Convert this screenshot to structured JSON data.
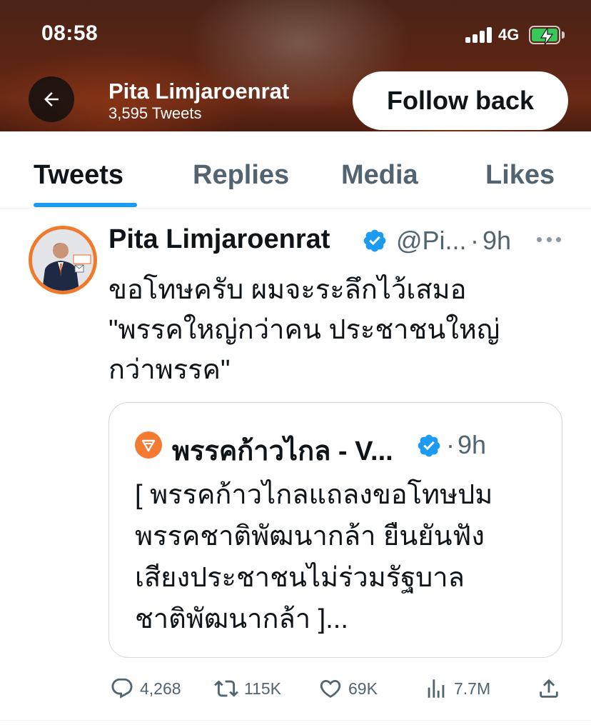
{
  "status_bar": {
    "time": "08:58",
    "network": "4G"
  },
  "profile_header": {
    "name": "Pita Limjaroenrat",
    "tweet_count": "3,595 Tweets",
    "follow_label": "Follow back"
  },
  "tabs": [
    {
      "label": "Tweets",
      "active": true
    },
    {
      "label": "Replies",
      "active": false
    },
    {
      "label": "Media",
      "active": false
    },
    {
      "label": "Likes",
      "active": false
    }
  ],
  "tweet": {
    "author_name": "Pita Limjaroenrat",
    "handle": "@Pi...",
    "separator": "·",
    "time": "9h",
    "text": "ขอโทษครับ ผมจะระลึกไว้เสมอ\n\"พรรคใหญ่กว่าคน ประชาชนใหญ่\nกว่าพรรค\"",
    "quote": {
      "author_name": "พรรคก้าวไกล - V...",
      "separator": "·",
      "time": "9h",
      "text": "[ พรรคก้าวไกลแถลงขอโทษปม\nพรรคชาติพัฒนากล้า ยืนยันฟัง\nเสียงประชาชนไม่ร่วมรัฐบาล\nชาติพัฒนากล้า ]..."
    },
    "actions": {
      "replies": "4,268",
      "retweets": "115K",
      "likes": "69K",
      "views": "7.7M"
    }
  },
  "colors": {
    "accent": "#1d9bf0",
    "secondary_text": "#536471",
    "battery": "#38c759"
  }
}
